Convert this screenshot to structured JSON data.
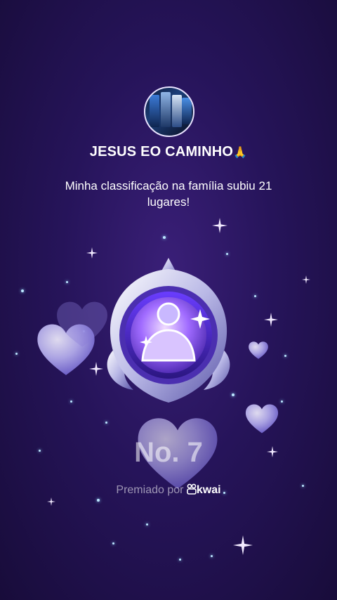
{
  "profile": {
    "name": "JESUS EO CAMINHO",
    "emoji": "🙏"
  },
  "message": "Minha classificação na família subiu 21 lugares!",
  "rank": {
    "label": "No. 7"
  },
  "awarded": {
    "prefix": "Premiado por",
    "brand": "kwai"
  },
  "colors": {
    "background": "#26145a",
    "accent": "#b79cff",
    "heart": "#c7c3ff"
  },
  "icons": [
    "avatar-image",
    "medal-icon",
    "heart-icon",
    "sparkle-icon",
    "kwai-logo-icon",
    "praying-hands-emoji"
  ]
}
